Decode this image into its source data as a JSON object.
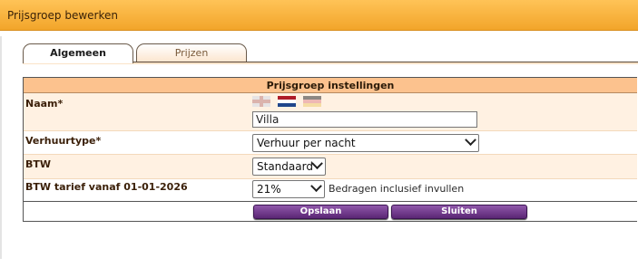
{
  "window": {
    "title": "Prijsgroep bewerken"
  },
  "tabs": [
    {
      "label": "Algemeen",
      "active": true
    },
    {
      "label": "Prijzen",
      "active": false
    }
  ],
  "section": {
    "title": "Prijsgroep instellingen"
  },
  "fields": {
    "naam": {
      "label": "Naam*",
      "value": "Villa",
      "flags": [
        "flag-uk-icon",
        "flag-nl-icon",
        "flag-de-icon"
      ]
    },
    "verhuurtype": {
      "label": "Verhuurtype*",
      "value": "Verhuur per nacht"
    },
    "btw": {
      "label": "BTW",
      "value": "Standaard"
    },
    "btw_tarief": {
      "label": "BTW tarief vanaf 01-01-2026",
      "value": "21%",
      "note": "Bedragen inclusief invullen"
    }
  },
  "buttons": {
    "save": "Opslaan",
    "close": "Sluiten"
  },
  "colors": {
    "titlebar": "#f2a52a",
    "header": "#fcc28e",
    "row_alt": "#fff1e2",
    "button": "#5b2675"
  }
}
